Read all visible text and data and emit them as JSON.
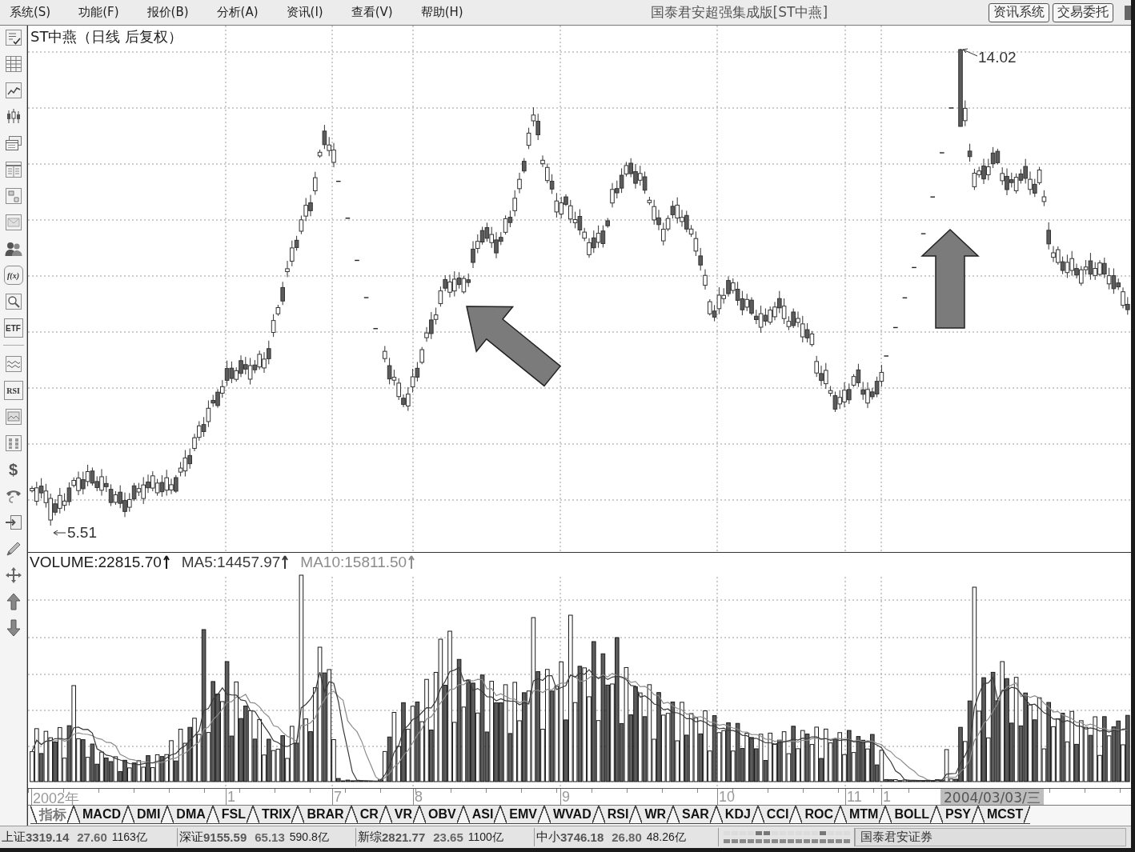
{
  "menu_bar": {
    "items": [
      "系统(S)",
      "功能(F)",
      "报价(B)",
      "分析(A)",
      "资讯(I)",
      "查看(V)",
      "帮助(H)"
    ],
    "title": "国泰君安超强集成版[ST中燕]",
    "buttons": [
      "资讯系统",
      "交易委托"
    ]
  },
  "left_toolbar": {
    "labels": [
      "f(x)",
      "ETF",
      "RSI",
      "$"
    ]
  },
  "price_chart": {
    "title": "ST中燕（日线 后复权）",
    "high_label": "14.02",
    "low_label": "5.51"
  },
  "volume_chart": {
    "legend": [
      {
        "label": "VOLUME:22815.70",
        "color": "#1a1a1a"
      },
      {
        "label": "MA5:14457.97",
        "color": "#3a3a3a"
      },
      {
        "label": "MA10:15811.50",
        "color": "#8c8c8c"
      }
    ]
  },
  "date_axis": {
    "labels": [
      "2002年",
      "1",
      "7",
      "8",
      "9",
      "10",
      "11",
      "1"
    ],
    "cursor_date": "2004/03/03/三"
  },
  "indicator_tabs": [
    {
      "label": "指标",
      "selected": true
    },
    {
      "label": "MACD",
      "selected": false
    },
    {
      "label": "DMI",
      "selected": false
    },
    {
      "label": "DMA",
      "selected": false
    },
    {
      "label": "FSL",
      "selected": false
    },
    {
      "label": "TRIX",
      "selected": false
    },
    {
      "label": "BRAR",
      "selected": false
    },
    {
      "label": "CR",
      "selected": false
    },
    {
      "label": "VR",
      "selected": false
    },
    {
      "label": "OBV",
      "selected": false
    },
    {
      "label": "ASI",
      "selected": false
    },
    {
      "label": "EMV",
      "selected": false
    },
    {
      "label": "WVAD",
      "selected": false
    },
    {
      "label": "RSI",
      "selected": false
    },
    {
      "label": "WR",
      "selected": false
    },
    {
      "label": "SAR",
      "selected": false
    },
    {
      "label": "KDJ",
      "selected": false
    },
    {
      "label": "CCI",
      "selected": false
    },
    {
      "label": "ROC",
      "selected": false
    },
    {
      "label": "MTM",
      "selected": false
    },
    {
      "label": "BOLL",
      "selected": false
    },
    {
      "label": "PSY",
      "selected": false
    },
    {
      "label": "MCST",
      "selected": false
    }
  ],
  "status_bar": {
    "indices": [
      {
        "name": "上证",
        "value": "3319.14",
        "change": "27.60",
        "amount": "1163亿"
      },
      {
        "name": "深证",
        "value": "9155.59",
        "change": "65.13",
        "amount": "590.8亿"
      },
      {
        "name": "新综",
        "value": "2821.77",
        "change": "23.65",
        "amount": "1100亿"
      },
      {
        "name": "中小",
        "value": "3746.18",
        "change": "26.80",
        "amount": "48.26亿"
      }
    ],
    "broker": "国泰君安证券"
  }
}
